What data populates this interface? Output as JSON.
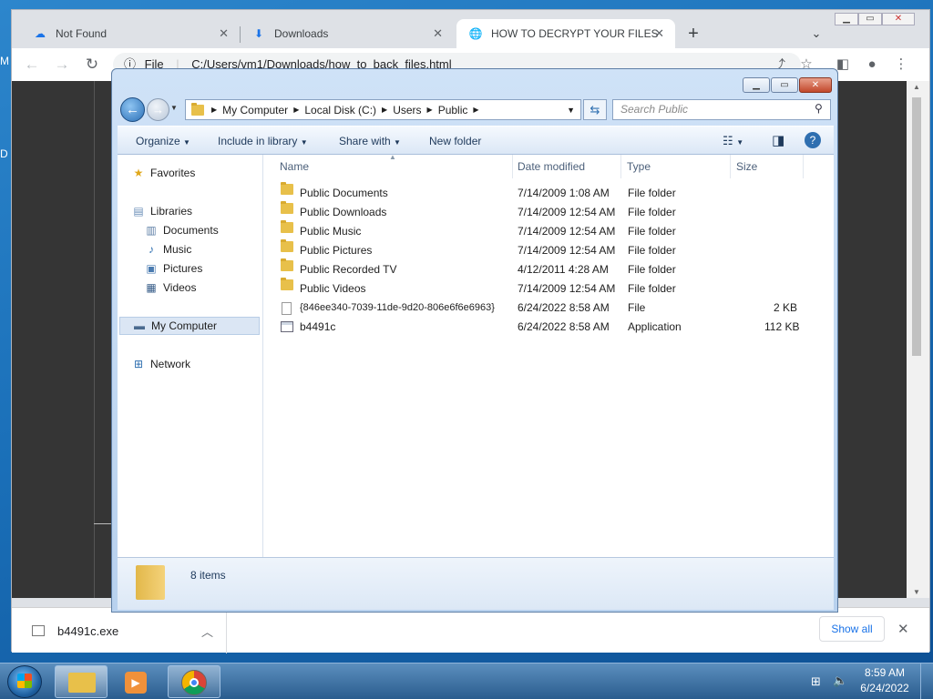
{
  "desktop": {
    "glyph_top": "M",
    "glyph_mid": "D"
  },
  "chrome": {
    "tabs": [
      {
        "label": "Not Found",
        "icon": "cloud-icon"
      },
      {
        "label": "Downloads",
        "icon": "download-icon"
      },
      {
        "label": "HOW TO DECRYPT YOUR FILES",
        "icon": "globe-icon"
      }
    ],
    "url_prefix": "File",
    "url": "C:/Users/vm1/Downloads/how_to_back_files.html",
    "download": {
      "filename": "b4491c.exe",
      "show_all": "Show all"
    }
  },
  "explorer": {
    "breadcrumb": [
      "My Computer",
      "Local Disk (C:)",
      "Users",
      "Public"
    ],
    "search_placeholder": "Search Public",
    "commands": [
      "Organize",
      "Include in library",
      "Share with",
      "New folder"
    ],
    "nav": {
      "favorites": "Favorites",
      "libraries": "Libraries",
      "library_items": [
        "Documents",
        "Music",
        "Pictures",
        "Videos"
      ],
      "computer": "My Computer",
      "network": "Network"
    },
    "columns": [
      "Name",
      "Date modified",
      "Type",
      "Size"
    ],
    "files": [
      {
        "name": "Public Documents",
        "date": "7/14/2009 1:08 AM",
        "type": "File folder",
        "size": "",
        "icon": "folder"
      },
      {
        "name": "Public Downloads",
        "date": "7/14/2009 12:54 AM",
        "type": "File folder",
        "size": "",
        "icon": "folder"
      },
      {
        "name": "Public Music",
        "date": "7/14/2009 12:54 AM",
        "type": "File folder",
        "size": "",
        "icon": "folder"
      },
      {
        "name": "Public Pictures",
        "date": "7/14/2009 12:54 AM",
        "type": "File folder",
        "size": "",
        "icon": "folder"
      },
      {
        "name": "Public Recorded TV",
        "date": "4/12/2011 4:28 AM",
        "type": "File folder",
        "size": "",
        "icon": "folder"
      },
      {
        "name": "Public Videos",
        "date": "7/14/2009 12:54 AM",
        "type": "File folder",
        "size": "",
        "icon": "folder"
      },
      {
        "name": "{846ee340-7039-11de-9d20-806e6f6e6963}",
        "date": "6/24/2022 8:58 AM",
        "type": "File",
        "size": "2 KB",
        "icon": "file"
      },
      {
        "name": "b4491c",
        "date": "6/24/2022 8:58 AM",
        "type": "Application",
        "size": "112 KB",
        "icon": "app"
      }
    ],
    "item_count": "8 items"
  },
  "taskbar": {
    "time": "8:59 AM",
    "date": "6/24/2022"
  }
}
